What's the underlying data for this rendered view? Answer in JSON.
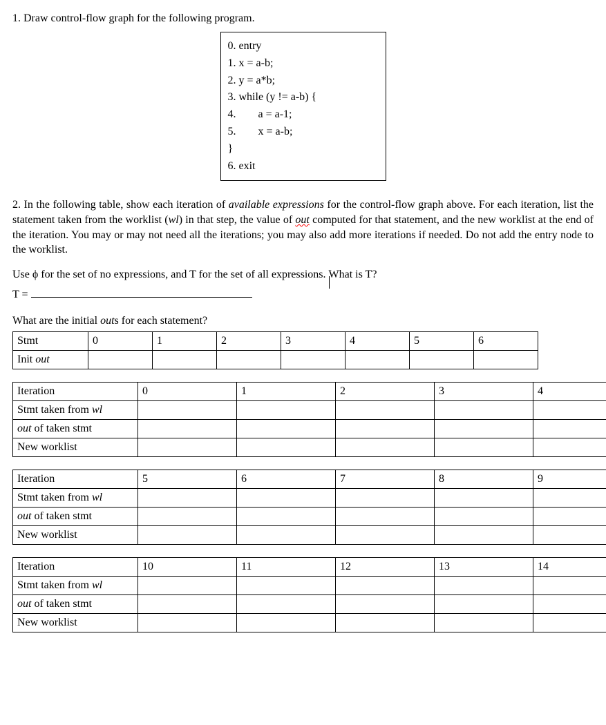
{
  "q1": {
    "prompt": "1. Draw control-flow graph for the following program.",
    "code": [
      "0. entry",
      "1. x = a-b;",
      "2. y = a*b;",
      "3. while (y != a-b) {",
      "4.        a = a-1;",
      "5.        x = a-b;",
      "}",
      "6. exit"
    ]
  },
  "q2": {
    "para_parts": {
      "a": "2. In the following table, show each iteration of ",
      "avail_expr": "available expressions",
      "b": " for the control-flow graph above. For each iteration, list the statement taken from the worklist (",
      "wl": "wl",
      "c": ") in that step, the value of ",
      "out_word": "out",
      "d": " computed for that statement, and the new worklist at the end of the iteration. You may or may not need all the iterations; you may also add more iterations if needed. Do not add the entry node to the worklist."
    },
    "t_line_a": "Use ϕ for the set of no expressions, and T for the set of all expressions. ",
    "t_line_b": "What is T?",
    "t_eq": "T = ",
    "init_prompt_a": "What are the initial ",
    "init_prompt_out": "out",
    "init_prompt_b": "s for each statement?"
  },
  "init_table": {
    "row0": {
      "label": "Stmt",
      "c0": "0",
      "c1": "1",
      "c2": "2",
      "c3": "3",
      "c4": "4",
      "c5": "5",
      "c6": "6"
    },
    "row1": {
      "label_a": "Init ",
      "label_out": "out",
      "c0": "",
      "c1": "",
      "c2": "",
      "c3": "",
      "c4": "",
      "c5": "",
      "c6": ""
    }
  },
  "iter_tables": [
    {
      "hdr": {
        "label": "Iteration",
        "c0": "0",
        "c1": "1",
        "c2": "2",
        "c3": "3",
        "c4": "4"
      },
      "rows": [
        {
          "label_a": "Stmt taken from ",
          "label_i": "wl"
        },
        {
          "label_i": "out",
          "label_b": " of taken stmt"
        },
        {
          "label_a": "New worklist"
        }
      ]
    },
    {
      "hdr": {
        "label": "Iteration",
        "c0": "5",
        "c1": "6",
        "c2": "7",
        "c3": "8",
        "c4": "9"
      },
      "rows": [
        {
          "label_a": "Stmt taken from ",
          "label_i": "wl"
        },
        {
          "label_i": "out",
          "label_b": " of taken stmt"
        },
        {
          "label_a": "New worklist"
        }
      ]
    },
    {
      "hdr": {
        "label": "Iteration",
        "c0": "10",
        "c1": "11",
        "c2": "12",
        "c3": "13",
        "c4": "14"
      },
      "rows": [
        {
          "label_a": "Stmt taken from ",
          "label_i": "wl"
        },
        {
          "label_i": "out",
          "label_b": " of taken stmt"
        },
        {
          "label_a": "New worklist"
        }
      ]
    }
  ]
}
